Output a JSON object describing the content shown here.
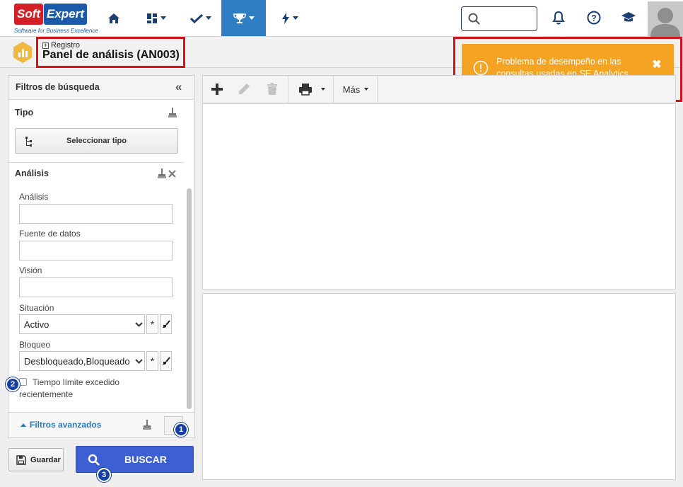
{
  "app": {
    "logo_soft": "Soft",
    "logo_expert": "Expert",
    "logo_tagline": "Software for Business Excellence"
  },
  "nav": {
    "items": [
      {
        "icon": "home-icon",
        "has_dropdown": false,
        "active": false
      },
      {
        "icon": "dashboard-icon",
        "has_dropdown": true,
        "active": false
      },
      {
        "icon": "check-icon",
        "has_dropdown": true,
        "active": false
      },
      {
        "icon": "trophy-icon",
        "has_dropdown": true,
        "active": true
      },
      {
        "icon": "bolt-icon",
        "has_dropdown": true,
        "active": false
      }
    ],
    "search_placeholder": "",
    "active_color": "#2f7ec3"
  },
  "header": {
    "breadcrumb": "Registro",
    "title": "Panel de análisis (AN003)"
  },
  "toast": {
    "message": "Problema de desempeño en las consultas usadas en SE Analytics.",
    "color": "#f5a323"
  },
  "filters": {
    "panel_title": "Filtros de búsqueda",
    "type_section": "Tipo",
    "select_type_button": "Seleccionar tipo",
    "analysis_section": "Análisis",
    "fields": {
      "analysis_label": "Análisis",
      "analysis_value": "",
      "data_source_label": "Fuente de datos",
      "data_source_value": "",
      "vision_label": "Visión",
      "vision_value": "",
      "status_label": "Situación",
      "status_value": "Activo",
      "block_label": "Bloqueo",
      "block_value": "Desbloqueado,Bloqueado"
    },
    "checkbox_label": "Tiempo límite excedido recientemente",
    "checkbox_checked": false,
    "advanced_label": "Filtros avanzados",
    "save_button": "Guardar",
    "search_button": "BUSCAR",
    "search_color": "#3c5fd3"
  },
  "toolbar": {
    "more_label": "Más"
  },
  "badges": {
    "one": "1",
    "two": "2",
    "three": "3"
  },
  "highlight_color": "#d0141a"
}
